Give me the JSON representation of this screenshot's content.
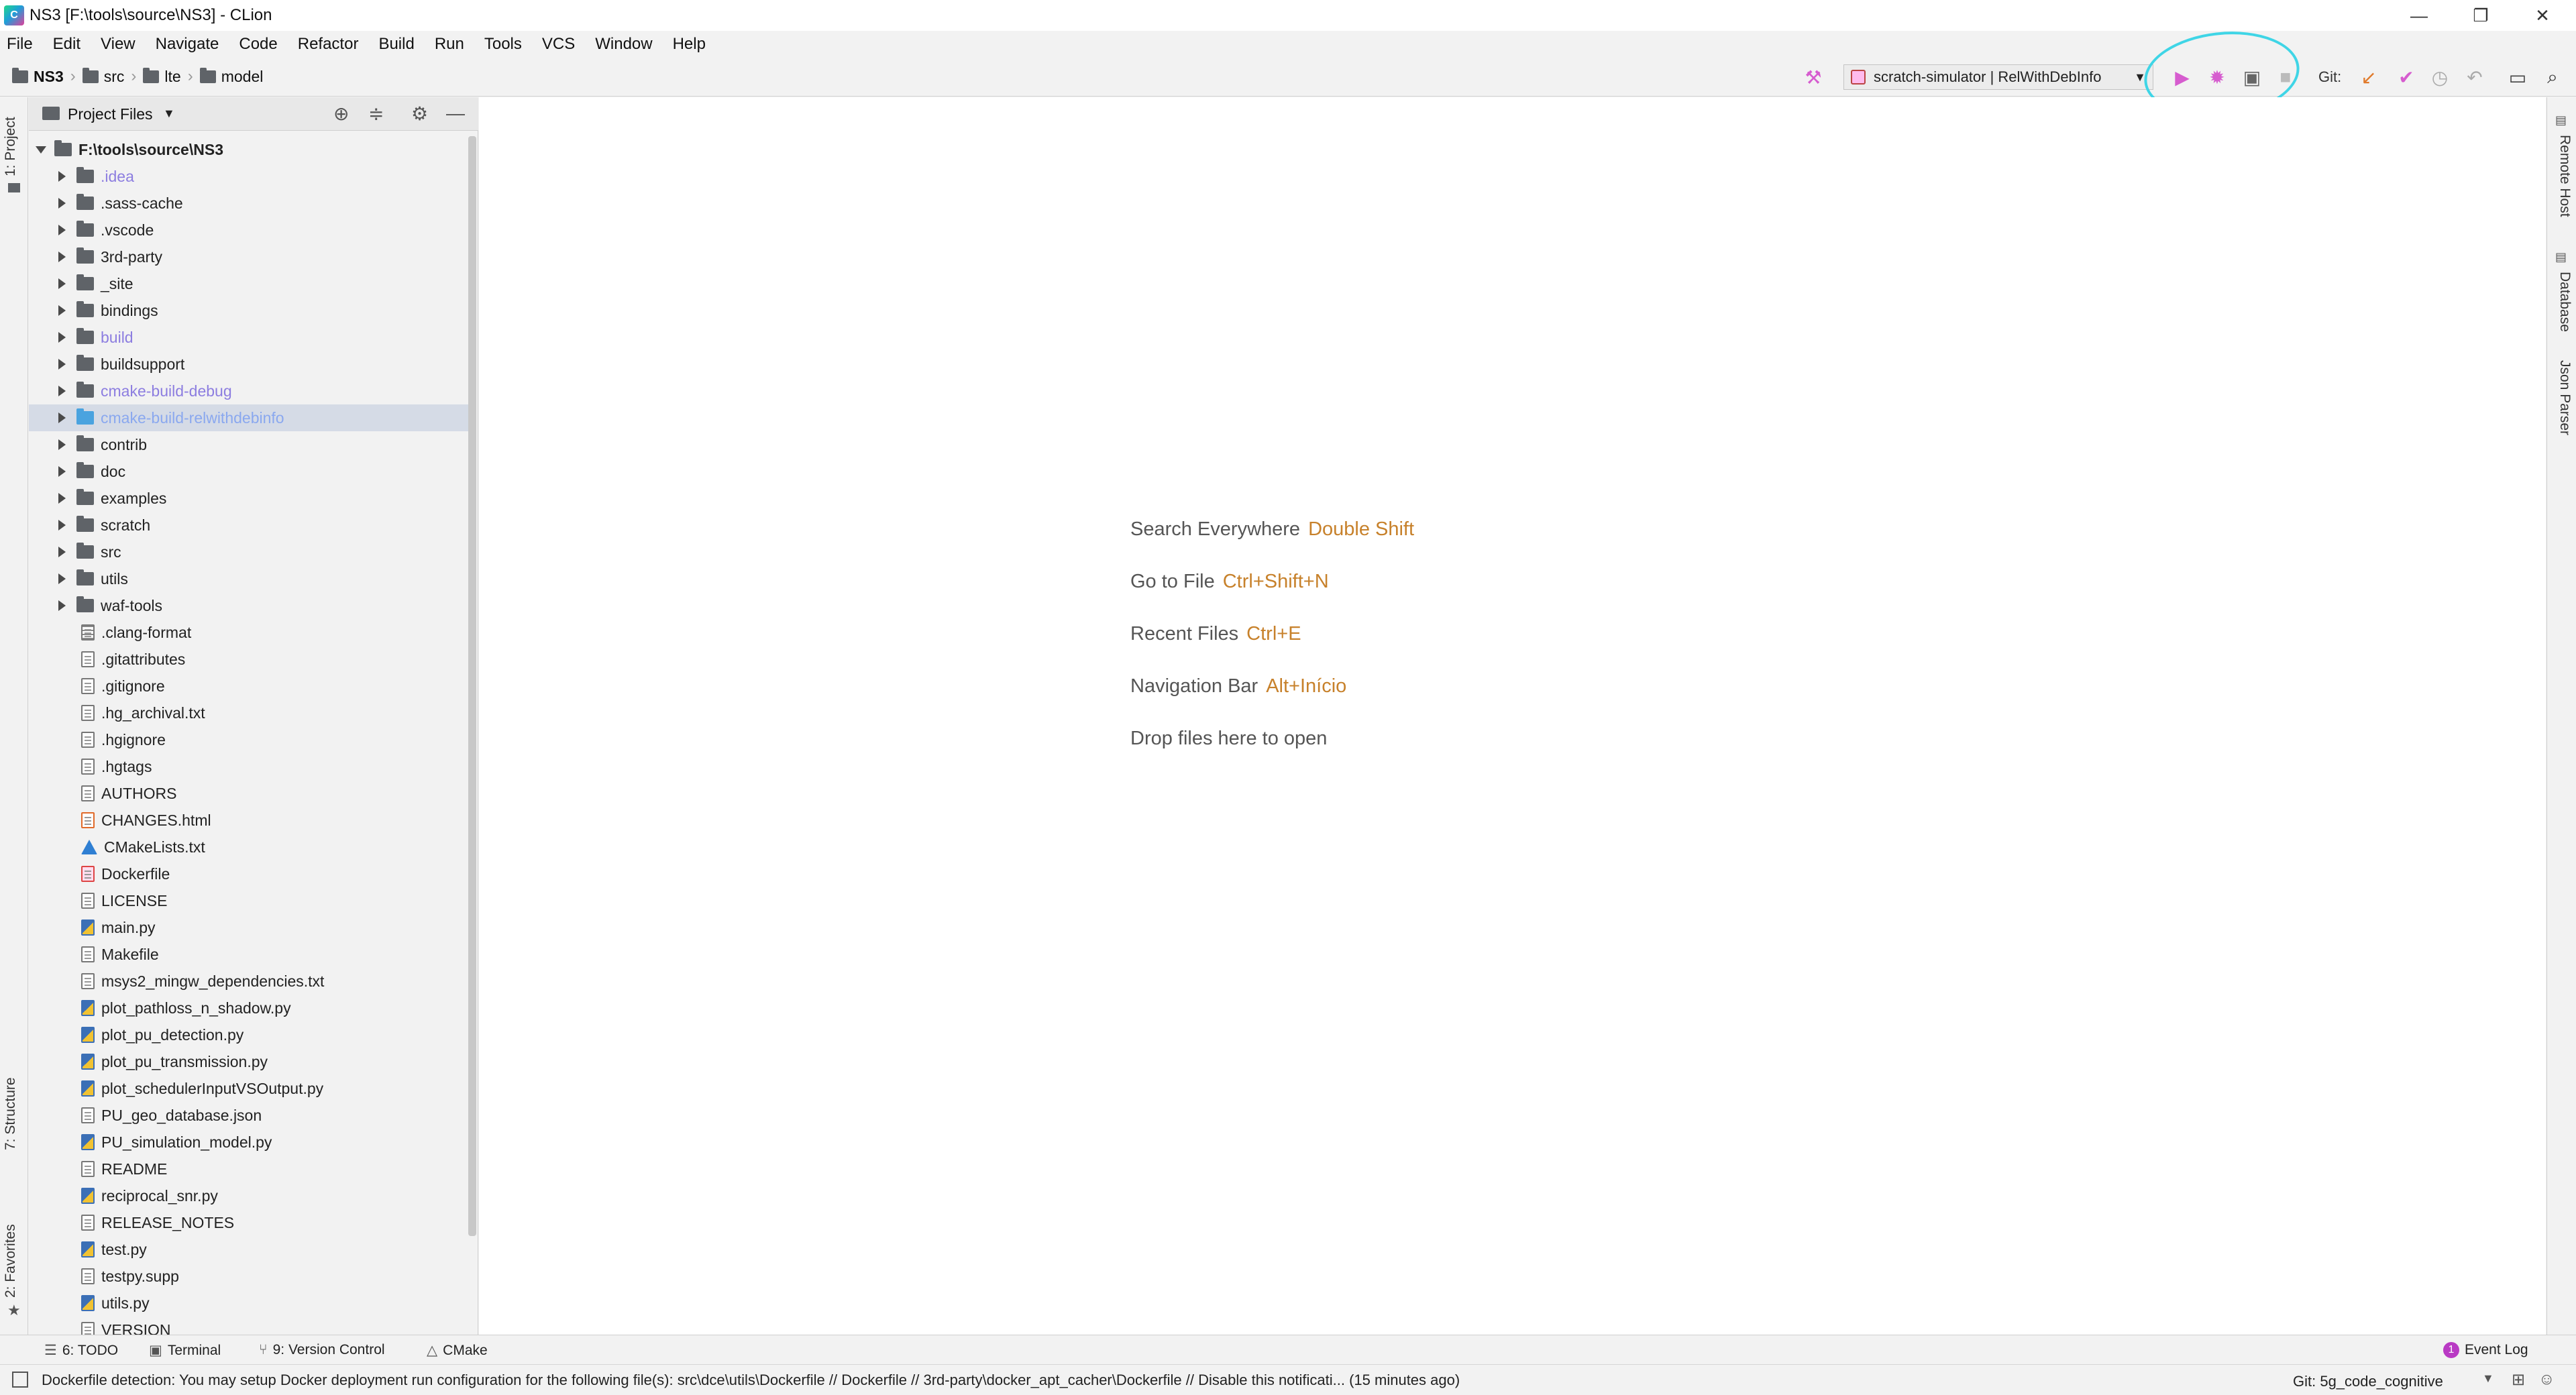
{
  "window": {
    "title": "NS3 [F:\\tools\\source\\NS3] - CLion",
    "controls": {
      "minimize": "—",
      "maximize": "❐",
      "close": "✕"
    }
  },
  "menu": [
    "File",
    "Edit",
    "View",
    "Navigate",
    "Code",
    "Refactor",
    "Build",
    "Run",
    "Tools",
    "VCS",
    "Window",
    "Help"
  ],
  "breadcrumb": [
    "NS3",
    "src",
    "lte",
    "model"
  ],
  "toolbar": {
    "run_config": "scratch-simulator | RelWithDebInfo",
    "git_label": "Git:",
    "accent_run": "#d65ccf",
    "annotation_color": "#3fd5e6"
  },
  "left_strip": {
    "project_tab": "1: Project",
    "structure_tab": "7: Structure",
    "favorites_tab": "2: Favorites"
  },
  "right_strip": {
    "remote_host": "Remote Host",
    "database": "Database",
    "json_parser": "Json Parser"
  },
  "project_panel": {
    "title": "Project Files",
    "root": "F:\\tools\\source\\NS3",
    "folders": [
      {
        "name": ".idea",
        "style": "excluded"
      },
      {
        "name": ".sass-cache",
        "style": "normal"
      },
      {
        "name": ".vscode",
        "style": "normal"
      },
      {
        "name": "3rd-party",
        "style": "normal"
      },
      {
        "name": "_site",
        "style": "normal"
      },
      {
        "name": "bindings",
        "style": "normal"
      },
      {
        "name": "build",
        "style": "excluded"
      },
      {
        "name": "buildsupport",
        "style": "normal"
      },
      {
        "name": "cmake-build-debug",
        "style": "excluded"
      },
      {
        "name": "cmake-build-relwithdebinfo",
        "style": "selected"
      },
      {
        "name": "contrib",
        "style": "normal"
      },
      {
        "name": "doc",
        "style": "normal"
      },
      {
        "name": "examples",
        "style": "normal"
      },
      {
        "name": "scratch",
        "style": "normal"
      },
      {
        "name": "src",
        "style": "normal"
      },
      {
        "name": "utils",
        "style": "normal"
      },
      {
        "name": "waf-tools",
        "style": "normal"
      }
    ],
    "files": [
      {
        "name": ".clang-format",
        "kind": "grid"
      },
      {
        "name": ".gitattributes",
        "kind": "text"
      },
      {
        "name": ".gitignore",
        "kind": "text"
      },
      {
        "name": ".hg_archival.txt",
        "kind": "text"
      },
      {
        "name": ".hgignore",
        "kind": "text"
      },
      {
        "name": ".hgtags",
        "kind": "text"
      },
      {
        "name": "AUTHORS",
        "kind": "text"
      },
      {
        "name": "CHANGES.html",
        "kind": "html"
      },
      {
        "name": "CMakeLists.txt",
        "kind": "cmake"
      },
      {
        "name": "Dockerfile",
        "kind": "docker"
      },
      {
        "name": "LICENSE",
        "kind": "text"
      },
      {
        "name": "main.py",
        "kind": "py"
      },
      {
        "name": "Makefile",
        "kind": "text"
      },
      {
        "name": "msys2_mingw_dependencies.txt",
        "kind": "text"
      },
      {
        "name": "plot_pathloss_n_shadow.py",
        "kind": "py"
      },
      {
        "name": "plot_pu_detection.py",
        "kind": "py"
      },
      {
        "name": "plot_pu_transmission.py",
        "kind": "py"
      },
      {
        "name": "plot_schedulerInputVSOutput.py",
        "kind": "py"
      },
      {
        "name": "PU_geo_database.json",
        "kind": "text"
      },
      {
        "name": "PU_simulation_model.py",
        "kind": "py"
      },
      {
        "name": "README",
        "kind": "text"
      },
      {
        "name": "reciprocal_snr.py",
        "kind": "py"
      },
      {
        "name": "RELEASE_NOTES",
        "kind": "text"
      },
      {
        "name": "test.py",
        "kind": "py"
      },
      {
        "name": "testpy.supp",
        "kind": "text"
      },
      {
        "name": "utils.py",
        "kind": "py"
      },
      {
        "name": "VERSION",
        "kind": "text"
      }
    ]
  },
  "editor_hints": [
    {
      "label": "Search Everywhere",
      "key": "Double Shift"
    },
    {
      "label": "Go to File",
      "key": "Ctrl+Shift+N"
    },
    {
      "label": "Recent Files",
      "key": "Ctrl+E"
    },
    {
      "label": "Navigation Bar",
      "key": "Alt+Início"
    },
    {
      "label": "Drop files here to open",
      "key": ""
    }
  ],
  "bottom_tools": {
    "todo": "6: TODO",
    "terminal": "Terminal",
    "version_control": "9: Version Control",
    "cmake": "CMake",
    "event_log": "Event Log",
    "event_count": "1"
  },
  "status": {
    "message": "Dockerfile detection: You may setup Docker deployment run configuration for the following file(s): src\\dce\\utils\\Dockerfile // Dockerfile // 3rd-party\\docker_apt_cacher\\Dockerfile // Disable this notificati... (15 minutes ago)",
    "git_branch": "Git: 5g_code_cognitive"
  }
}
